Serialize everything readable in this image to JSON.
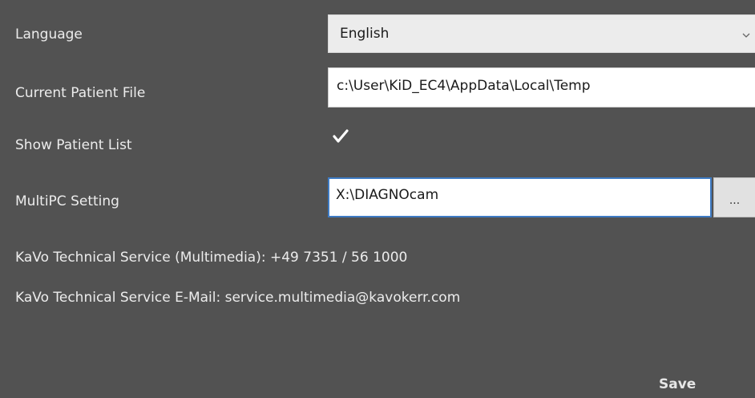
{
  "settings": {
    "language": {
      "label": "Language",
      "value": "English"
    },
    "patient_file": {
      "label": "Current Patient File",
      "value": "c:\\User\\KiD_EC4\\AppData\\Local\\Temp"
    },
    "show_patient_list": {
      "label": "Show Patient List",
      "checked": true
    },
    "multipc": {
      "label": "MultiPC Setting",
      "value": "X:\\DIAGNOcam",
      "browse_label": "..."
    }
  },
  "info": {
    "phone": "KaVo Technical Service (Multimedia): +49 7351 / 56 1000",
    "email": "KaVo Technical Service E-Mail: service.multimedia@kavokerr.com"
  },
  "actions": {
    "save_label": "Save"
  },
  "icons": {
    "dropdown": "chevron-down-icon",
    "checkbox": "checkmark-icon"
  },
  "colors": {
    "background": "#525252",
    "focus_border": "#3e7bc4",
    "text": "#ececec"
  }
}
